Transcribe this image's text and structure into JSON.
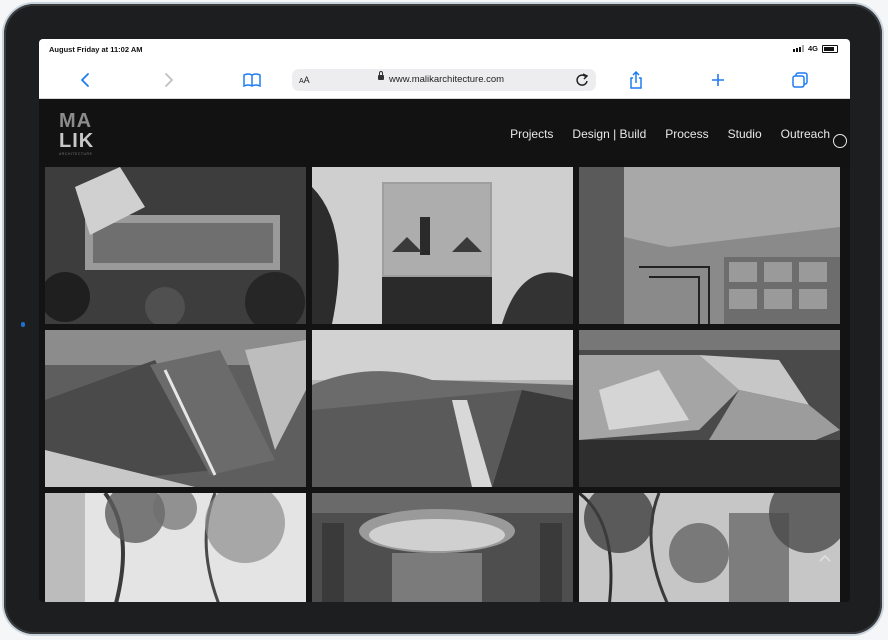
{
  "status": {
    "time": "August Friday at 11:02 AM",
    "network": "4G"
  },
  "browser": {
    "text_size_label_small": "A",
    "text_size_label_big": "A",
    "url": "www.malikarchitecture.com"
  },
  "site": {
    "logo_line1": "MA",
    "logo_line2": "LIK",
    "logo_tagline": "ARCHITECTURE",
    "nav": [
      "Projects",
      "Design | Build",
      "Process",
      "Studio",
      "Outreach"
    ]
  },
  "icons": [
    "back-icon",
    "forward-icon",
    "bookmarks-icon",
    "lock-icon",
    "reload-icon",
    "share-icon",
    "new-tab-icon",
    "tabs-icon",
    "scroll-up-icon"
  ],
  "colors": {
    "accent": "#1e7cf0",
    "site_bg": "#121212",
    "nav_text": "#e8e8e8"
  }
}
